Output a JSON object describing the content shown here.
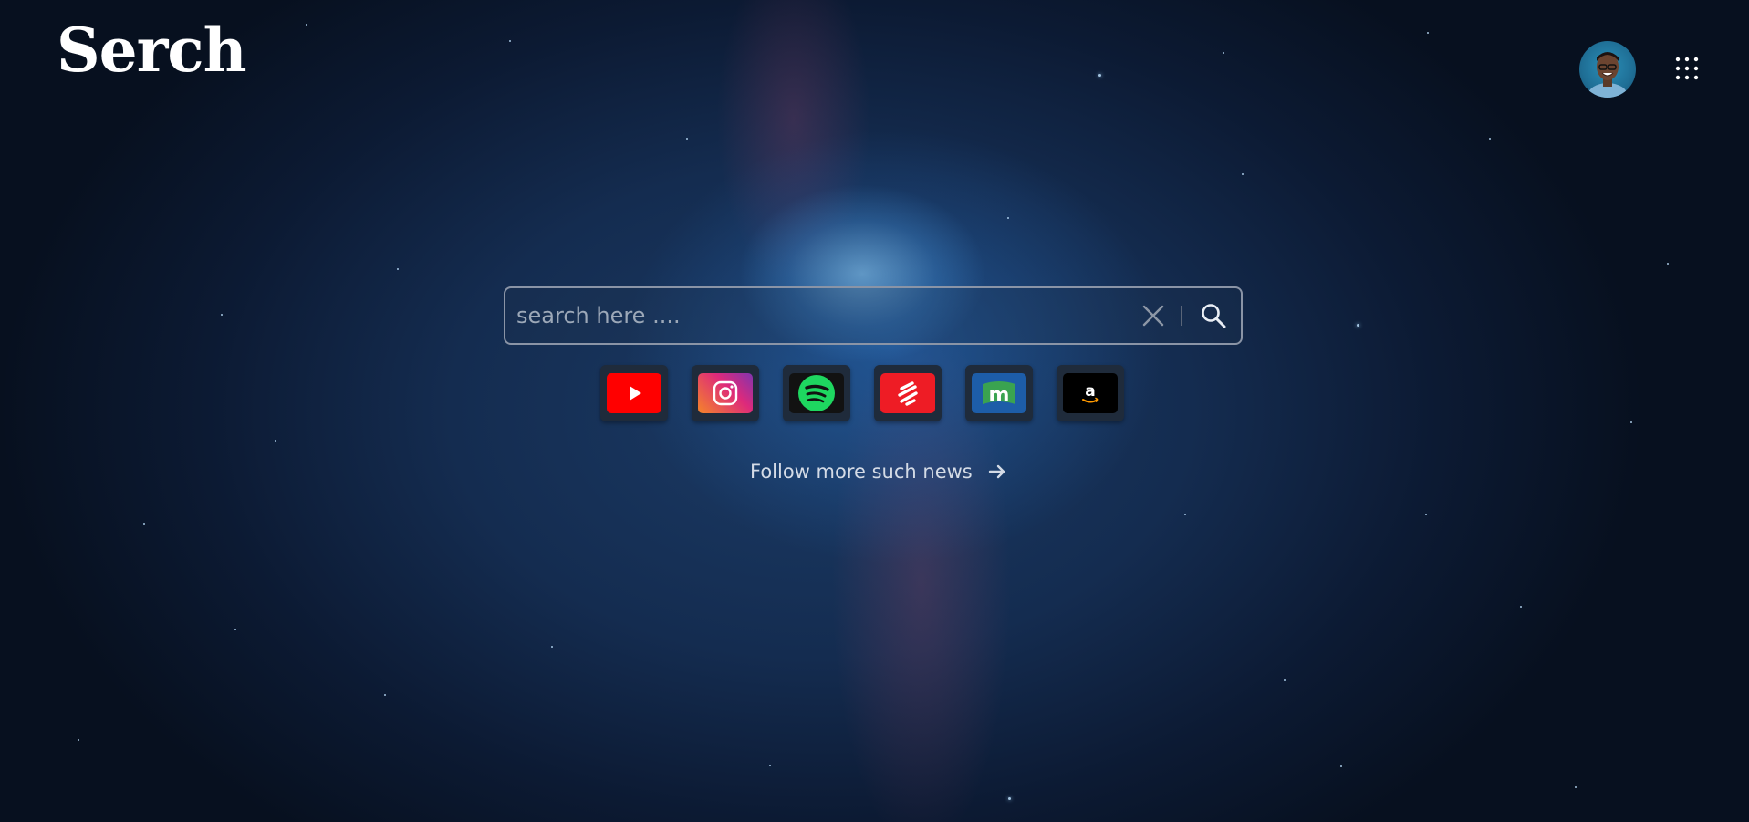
{
  "app": {
    "logo_text": "Serch"
  },
  "header": {
    "avatar_alt": "User profile",
    "apps_icon": "grid-dots-icon"
  },
  "search": {
    "placeholder": "search here ....",
    "value": "",
    "clear_icon": "close-icon",
    "submit_icon": "search-icon"
  },
  "shortcuts": [
    {
      "name": "YouTube",
      "icon": "youtube-icon",
      "color": "#ff0000"
    },
    {
      "name": "Instagram",
      "icon": "instagram-icon",
      "color": "#e1306c"
    },
    {
      "name": "Spotify",
      "icon": "spotify-icon",
      "color": "#1ed760"
    },
    {
      "name": "Indian Express",
      "icon": "indian-express-icon",
      "color": "#ee1c25"
    },
    {
      "name": "Moneycontrol",
      "icon": "moneycontrol-icon",
      "color": "#2b8a3e"
    },
    {
      "name": "Amazon",
      "icon": "amazon-icon",
      "color": "#000000"
    }
  ],
  "follow": {
    "label": "Follow more such news",
    "icon": "arrow-right-icon"
  }
}
